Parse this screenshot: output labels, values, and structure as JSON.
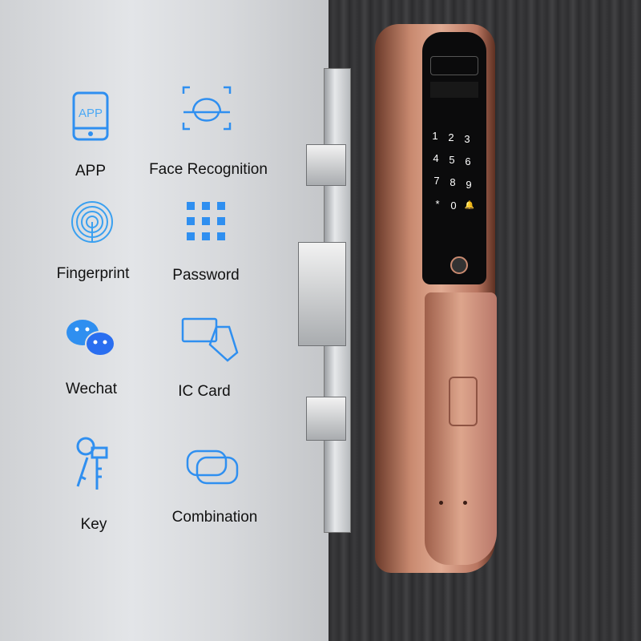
{
  "features": [
    {
      "label": "APP",
      "icon": "app-phone-icon",
      "icon_text": "APP"
    },
    {
      "label": "Face Recognition",
      "icon": "face-recognition-icon"
    },
    {
      "label": "Fingerprint",
      "icon": "fingerprint-icon"
    },
    {
      "label": "Password",
      "icon": "keypad-grid-icon"
    },
    {
      "label": "Wechat",
      "icon": "wechat-icon"
    },
    {
      "label": "IC Card",
      "icon": "ic-card-icon"
    },
    {
      "label": "Key",
      "icon": "key-icon"
    },
    {
      "label": "Combination",
      "icon": "combination-cards-icon"
    }
  ],
  "keypad": [
    "1",
    "2",
    "3",
    "4",
    "5",
    "6",
    "7",
    "8",
    "9",
    "*",
    "0",
    "🔔"
  ],
  "colors": {
    "icon_blue": "#2f8ff0",
    "lock_rose_gold": "#d49a80",
    "door": "#333335"
  }
}
